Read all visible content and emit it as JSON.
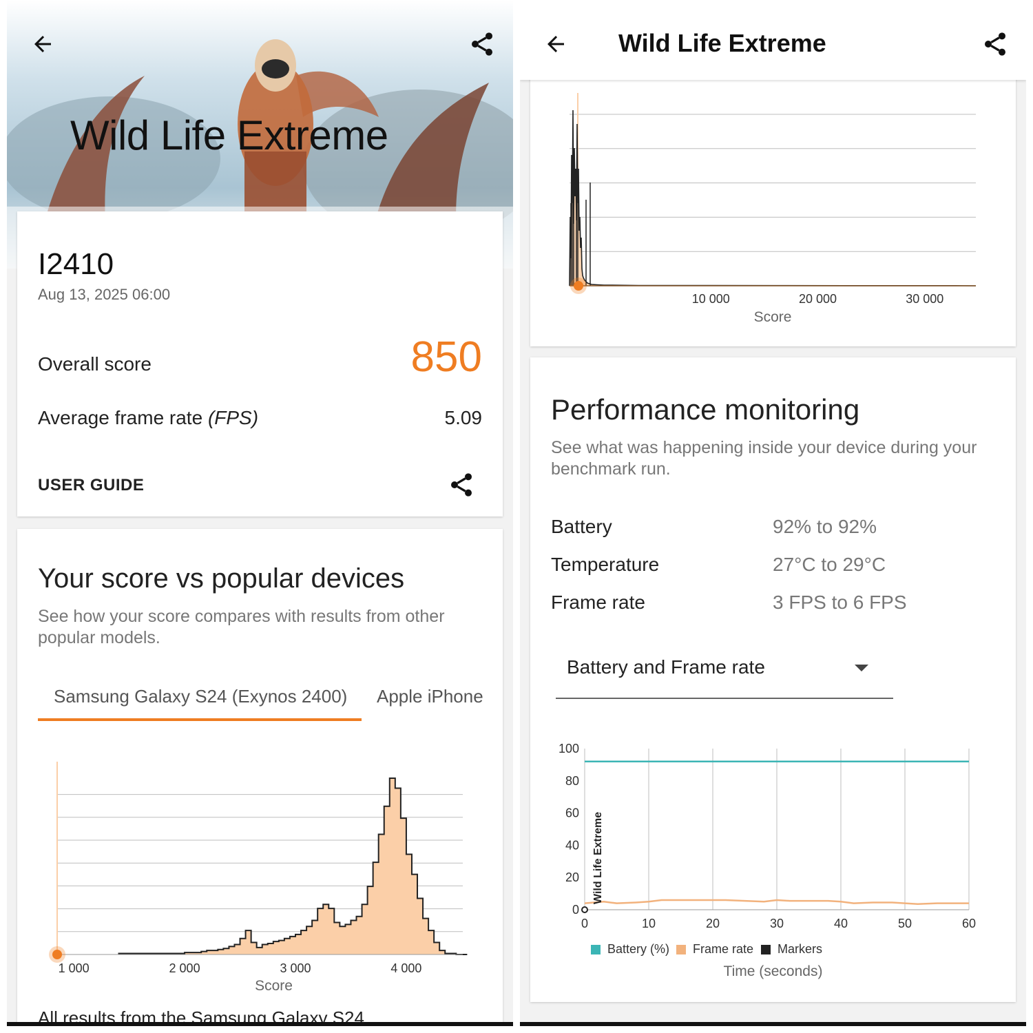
{
  "left": {
    "hero_title": "Wild Life Extreme",
    "result_card": {
      "device_name": "I2410",
      "timestamp": "Aug 13, 2025 06:00",
      "overall_label": "Overall score",
      "overall_value": "850",
      "fps_label_main": "Average frame rate ",
      "fps_label_unit": "(FPS)",
      "fps_value": "5.09",
      "user_guide_label": "USER GUIDE"
    },
    "compare_card": {
      "title": "Your score vs popular devices",
      "subtitle": "See how your score compares with results from other popular models.",
      "tabs": [
        "Samsung Galaxy S24 (Exynos 2400)",
        "Apple iPhone"
      ],
      "active_tab": 0,
      "footer_text": "All results from the Samsung Galaxy S24"
    }
  },
  "right": {
    "header_title": "Wild Life Extreme",
    "performance": {
      "title": "Performance monitoring",
      "subtitle": "See what was happening inside your device during your benchmark run.",
      "rows": [
        {
          "label": "Battery",
          "value": "92% to 92%"
        },
        {
          "label": "Temperature",
          "value": "27°C to 29°C"
        },
        {
          "label": "Frame rate",
          "value": "3 FPS to 6 FPS"
        }
      ],
      "dropdown_selected": "Battery and Frame rate"
    }
  },
  "colors": {
    "accent": "#ef7d22",
    "histogram_fill": "#fbcfa8",
    "battery_line": "#3bb5b5",
    "framerate_line": "#f2b27d",
    "markers": "#222222",
    "grid": "#bdbdbd"
  },
  "icons": {
    "back": "arrow-left-icon",
    "share": "share-icon",
    "dropdown": "caret-down-icon"
  },
  "chart_data": [
    {
      "type": "area",
      "name": "score-distribution-samsung-s24",
      "xlabel": "Score",
      "xticks": [
        "1 000",
        "2 000",
        "3 000",
        "4 000"
      ],
      "xlim": [
        850,
        4510
      ],
      "your_score": 850,
      "x": [
        1400,
        1500,
        1600,
        1700,
        1800,
        1900,
        2000,
        2100,
        2150,
        2200,
        2250,
        2300,
        2350,
        2400,
        2450,
        2500,
        2550,
        2600,
        2650,
        2700,
        2750,
        2800,
        2850,
        2900,
        2950,
        3000,
        3050,
        3100,
        3150,
        3200,
        3250,
        3300,
        3350,
        3400,
        3450,
        3500,
        3550,
        3600,
        3650,
        3700,
        3750,
        3800,
        3850,
        3900,
        3950,
        4000,
        4050,
        4100,
        4150,
        4200,
        4250,
        4300,
        4350,
        4400,
        4450,
        4500
      ],
      "values": [
        0.5,
        0.5,
        0.5,
        0.5,
        0.5,
        0.5,
        1,
        1,
        1.5,
        2,
        2,
        2.5,
        3,
        4,
        5,
        8,
        12,
        6,
        3.5,
        5,
        5.5,
        6.5,
        7,
        8,
        9,
        10,
        12,
        14,
        17,
        23,
        25,
        23,
        16,
        14,
        15,
        17,
        19,
        25,
        34,
        46,
        60,
        74,
        88,
        83,
        68,
        50,
        40,
        28,
        18,
        12,
        6,
        2,
        0.5,
        0.5,
        0,
        0
      ]
    },
    {
      "type": "area",
      "name": "score-distribution-all-devices",
      "xlabel": "Score",
      "xticks": [
        "10 000",
        "20 000",
        "30 000"
      ],
      "xlim": [
        0,
        38000
      ],
      "your_score": 850
    },
    {
      "type": "line",
      "name": "battery-and-frame-rate",
      "xlabel": "Time (seconds)",
      "ylim": [
        0,
        100
      ],
      "xlim": [
        0,
        60
      ],
      "yticks": [
        "0",
        "20",
        "40",
        "60",
        "80",
        "100"
      ],
      "xticks": [
        "0",
        "10",
        "20",
        "30",
        "40",
        "50",
        "60"
      ],
      "marker_label": "Wild Life Extreme",
      "series": [
        {
          "name": "Battery (%)",
          "x": [
            0,
            60
          ],
          "values": [
            92,
            92
          ]
        },
        {
          "name": "Frame rate",
          "x": [
            0,
            3,
            5,
            8,
            10,
            12,
            15,
            18,
            20,
            22,
            25,
            28,
            30,
            32,
            35,
            38,
            40,
            42,
            45,
            48,
            50,
            52,
            55,
            58,
            60
          ],
          "values": [
            4,
            5,
            4,
            4.5,
            5,
            6,
            6,
            6,
            6,
            6,
            5.5,
            5,
            6,
            5.5,
            5.5,
            5.5,
            5,
            4,
            4.5,
            4.5,
            4,
            3.5,
            4,
            4,
            4
          ]
        },
        {
          "name": "Markers",
          "x": [],
          "values": []
        }
      ]
    }
  ]
}
